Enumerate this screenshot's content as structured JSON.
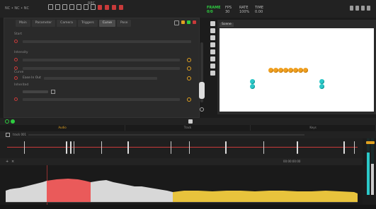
{
  "topbar": {
    "left_text": "NC • NC • NC",
    "center_label": "REC",
    "stats": [
      {
        "line1": "FRAME",
        "line2": "0/0",
        "green": true
      },
      {
        "line1": "FPS",
        "line2": "30",
        "green": false
      },
      {
        "line1": "RATE",
        "line2": "100%",
        "green": false
      },
      {
        "line1": "TIME",
        "line2": "0.00",
        "green": false
      }
    ]
  },
  "panel": {
    "tabs": [
      "Main",
      "Parameter",
      "Camera",
      "Triggers",
      "Curve",
      "Pose"
    ],
    "active_tab": 4,
    "rows": [
      {
        "label": "Start"
      },
      {
        "label": "Intensity"
      },
      {
        "label": "Curve"
      },
      {
        "label": "Inherited"
      }
    ],
    "curve_value": "Ease In Out"
  },
  "viewer": {
    "tab_label": "Scene"
  },
  "timeline": {
    "tabs": [
      "Audio",
      "Track",
      "Keys"
    ],
    "active_tab": 0,
    "track_label": "track 001",
    "time_readout": "00:00:00:00"
  }
}
